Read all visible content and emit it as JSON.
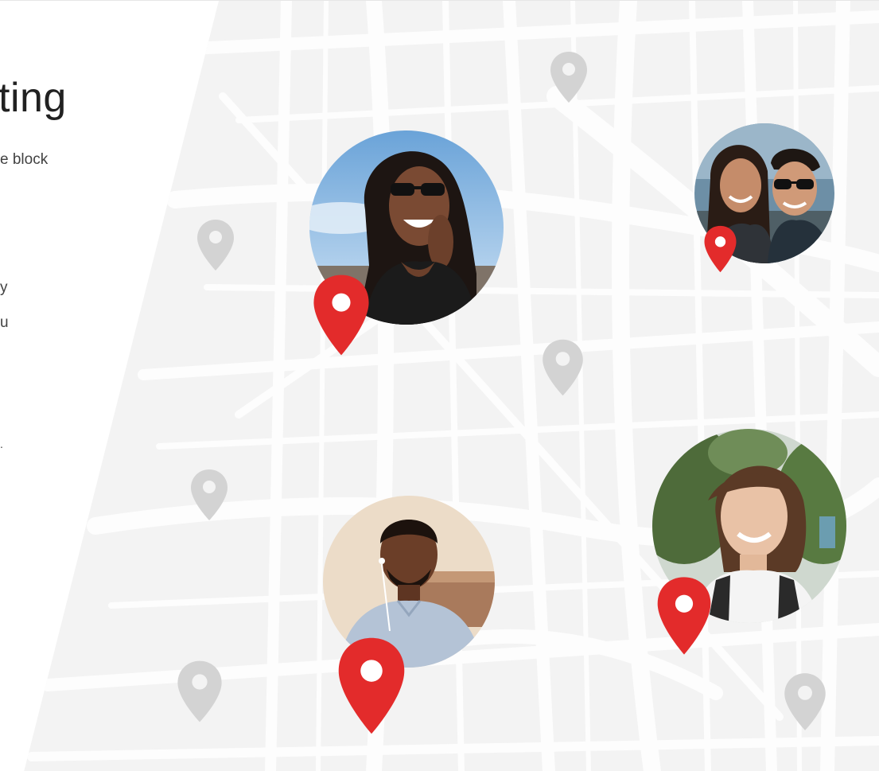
{
  "heading": "ting",
  "subline": "e block",
  "fragments": [
    "y",
    "u",
    "."
  ],
  "avatars": [
    {
      "label": "woman-with-sunglasses"
    },
    {
      "label": "couple-selfie"
    },
    {
      "label": "man-with-earbuds"
    },
    {
      "label": "woman-smiling"
    }
  ],
  "colors": {
    "pin_active": "#e32b2b",
    "pin_inactive": "#d3d3d3",
    "map_bg": "#f3f3f3",
    "street": "#fdfdfd",
    "text": "#212121"
  },
  "icons": {
    "pin": "location-pin-icon"
  }
}
